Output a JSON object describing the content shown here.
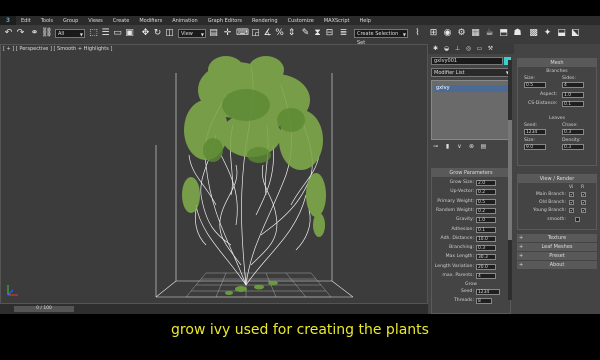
{
  "app": {
    "logo": "3"
  },
  "menu": [
    "Edit",
    "Tools",
    "Group",
    "Views",
    "Create",
    "Modifiers",
    "Animation",
    "Graph Editors",
    "Rendering",
    "Customize",
    "MAXScript",
    "Help"
  ],
  "toolbar": {
    "filter": "All",
    "view": "View",
    "selection_set": "Create Selection Set"
  },
  "viewport": {
    "label": "[ + ] [ Perspective ] [ Smooth + Highlights ]"
  },
  "timeline": {
    "frame": "0 / 100"
  },
  "command_panel": {
    "object_name": "gxIvy001",
    "object_color": "#3ad0d0",
    "modifier_list": "Modifier List",
    "stack_item": "gxIvy",
    "grow_parameters": {
      "title": "Grow Parameters",
      "params": [
        {
          "label": "Grow Size:",
          "value": "2.0"
        },
        {
          "label": "Up-Vector:",
          "value": "0.2"
        },
        {
          "label": "Primary Weight:",
          "value": "0.5"
        },
        {
          "label": "Random Weight:",
          "value": "0.2"
        },
        {
          "label": "Gravity:",
          "value": "1.0"
        },
        {
          "label": "Adhesion:",
          "value": "0.1"
        },
        {
          "label": "Adh. Distance:",
          "value": "10.0"
        },
        {
          "label": "Branching:",
          "value": "0.3"
        },
        {
          "label": "Max Length:",
          "value": "30.3"
        },
        {
          "label": "Length Variation:",
          "value": "20.0"
        },
        {
          "label": "max. Parents:",
          "value": "4"
        }
      ],
      "grow_group": "Grow",
      "seed_label": "Seed:",
      "seed_value": "1234",
      "threads_label": "Threads:",
      "threads_value": "8"
    }
  },
  "mesh_panel": {
    "title": "Mesh",
    "branches": {
      "group": "Branches",
      "size_label": "Size:",
      "size_value": "0.5",
      "sides_label": "Sides:",
      "sides_value": "4",
      "aspect_label": "Aspect:",
      "aspect_value": "1.0",
      "cs_label": "CS-Distance:",
      "cs_value": "0.1"
    },
    "leaves": {
      "group": "Leaves",
      "seed_label": "Seed:",
      "seed_value": "1234",
      "chase_label": "Chase:",
      "chase_value": "0.3",
      "size_label": "Size:",
      "size_value": "9.0",
      "density_label": "Density:",
      "density_value": "0.3"
    },
    "view_render": {
      "title": "View / Render",
      "cols": [
        "Vi",
        "R"
      ],
      "rows": [
        {
          "label": "Main Branch:",
          "vi": "✔",
          "r": "✔"
        },
        {
          "label": "Old Branch:",
          "vi": "✔",
          "r": "✔"
        },
        {
          "label": "Young Branch:",
          "vi": "✔",
          "r": "✔"
        },
        {
          "label": "smooth:",
          "vi": "",
          "r": ""
        }
      ]
    },
    "collapsed": [
      "Texture",
      "Leaf Meshes",
      "Preset",
      "About"
    ]
  },
  "caption": "grow ivy used for creating the plants"
}
